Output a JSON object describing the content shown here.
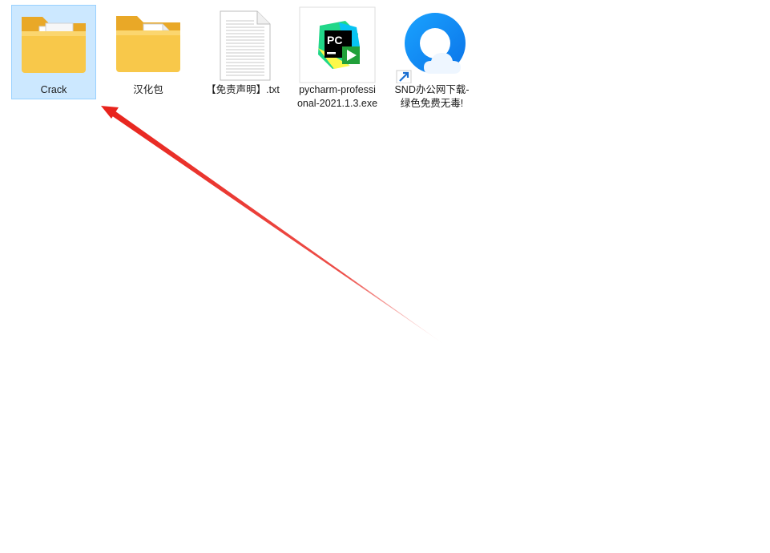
{
  "desktop": {
    "items": [
      {
        "name": "Crack",
        "type": "folder",
        "selected": true
      },
      {
        "name": "汉化包",
        "type": "folder",
        "selected": false
      },
      {
        "name": "【免责声明】.txt",
        "type": "text-file",
        "selected": false
      },
      {
        "name": "pycharm-professional-2021.1.3.exe",
        "type": "executable",
        "selected": false
      },
      {
        "name": "SND办公网下载-绿色免费无毒!",
        "type": "shortcut",
        "selected": false
      }
    ]
  },
  "icons": {
    "folder": "folder-icon",
    "text_file": "text-document-icon",
    "pycharm": "pycharm-icon",
    "browser_shortcut": "qq-browser-icon",
    "shortcut_overlay": "shortcut-arrow-icon",
    "annotation": "red-arrow-annotation"
  },
  "pycharm_badge": "PC",
  "colors": {
    "selection_fill": "#cce8ff",
    "selection_border": "#99d1ff",
    "folder_yellow": "#f8c84a",
    "annotation_red": "#e8231c"
  }
}
